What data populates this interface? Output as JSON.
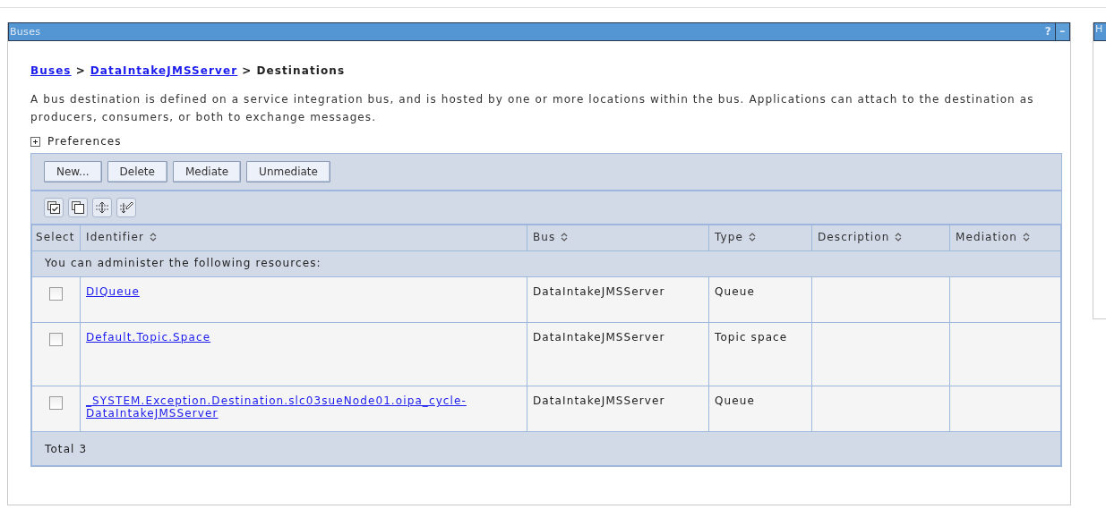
{
  "panel": {
    "title": "Buses",
    "help": "?",
    "minimize": "–"
  },
  "side_panel": {
    "title": "H"
  },
  "breadcrumb": {
    "separator": ">",
    "items": [
      {
        "label": "Buses",
        "link": true
      },
      {
        "label": "DataIntakeJMSServer",
        "link": true
      },
      {
        "label": "Destinations",
        "link": false
      }
    ]
  },
  "description": "A bus destination is defined on a service integration bus, and is hosted by one or more locations within the bus. Applications can attach to the destination as producers, consumers, or both to exchange messages.",
  "preferences": {
    "label": "Preferences",
    "expanded": false
  },
  "buttons": [
    "New...",
    "Delete",
    "Mediate",
    "Unmediate"
  ],
  "table": {
    "columns": [
      {
        "label": "Select",
        "sortable": false
      },
      {
        "label": "Identifier",
        "sortable": true
      },
      {
        "label": "Bus",
        "sortable": true
      },
      {
        "label": "Type",
        "sortable": true
      },
      {
        "label": "Description",
        "sortable": true
      },
      {
        "label": "Mediation",
        "sortable": true
      }
    ],
    "group_label": "You can administer the following resources:",
    "rows": [
      {
        "checked": false,
        "identifier": "DIQueue",
        "bus": "DataIntakeJMSServer",
        "type": "Queue"
      },
      {
        "checked": false,
        "identifier": "Default.Topic.Space",
        "bus": "DataIntakeJMSServer",
        "type": "Topic space"
      },
      {
        "checked": false,
        "identifier": "_SYSTEM.Exception.Destination.slc03sueNode01.oipa_cycle-DataIntakeJMSServer",
        "bus": "DataIntakeJMSServer",
        "type": "Queue"
      }
    ],
    "total": "Total 3"
  }
}
